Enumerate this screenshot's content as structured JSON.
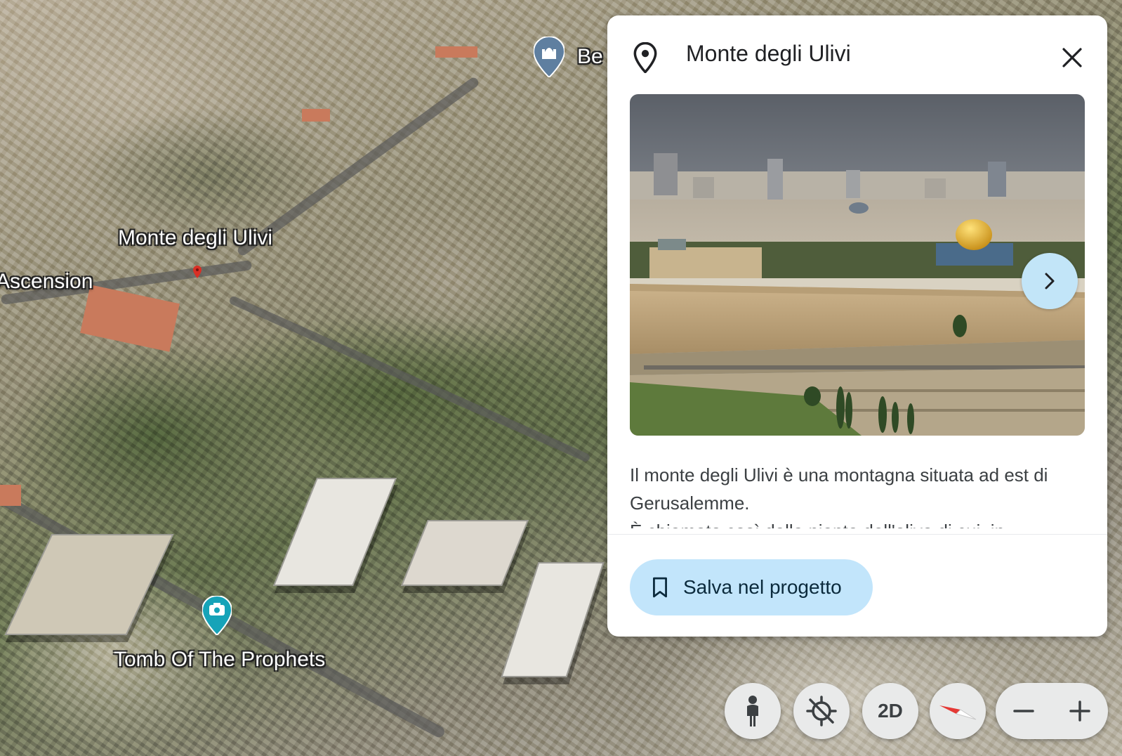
{
  "map": {
    "labels": {
      "mount": "Monte degli Ulivi",
      "ascension": "Ascension",
      "tomb": "Tomb Of The Prophets",
      "partial_top": "Be"
    }
  },
  "panel": {
    "title": "Monte degli Ulivi",
    "description_1": "Il monte degli Ulivi è una montagna situata ad est di Gerusalemme.",
    "description_2": "È chiamato così dalla pianta dell'olivo di cui, in",
    "save_label": "Salva nel progetto",
    "icons": {
      "place": "location-pin-icon",
      "close": "close-icon",
      "next": "chevron-right-icon",
      "save": "bookmark-icon"
    }
  },
  "controls": {
    "pegman": "pegman-icon",
    "my_location": "location-disabled-icon",
    "view_mode_label": "2D",
    "compass": "compass-icon",
    "zoom_out": "minus-icon",
    "zoom_in": "plus-icon"
  },
  "colors": {
    "panel_bg": "#ffffff",
    "save_button_bg": "#c2e5fb",
    "next_button_bg": "#c2e5f8",
    "control_bg": "#e9eaea",
    "compass_red": "#e53935",
    "map_pin_red": "#d93025",
    "tomb_marker": "#16a3b8"
  }
}
